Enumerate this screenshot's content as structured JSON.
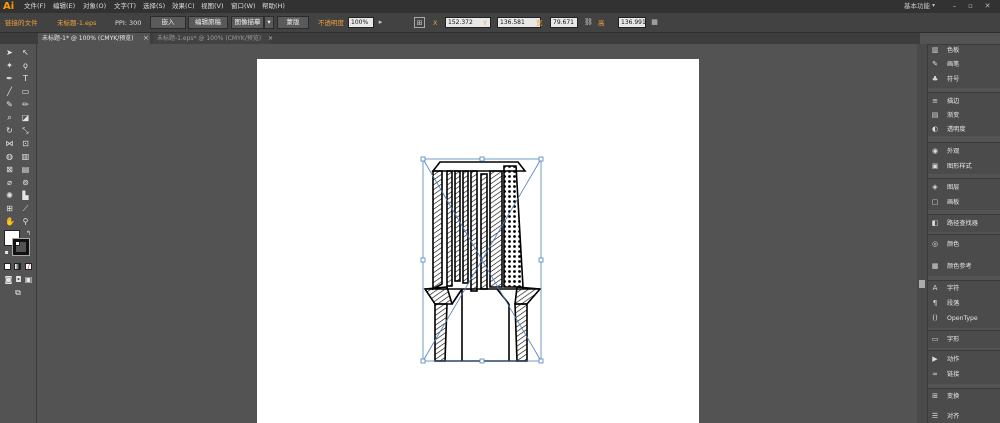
{
  "app": {
    "logo": "Ai",
    "workspace": "基本功能"
  },
  "menu": [
    "文件(F)",
    "编辑(E)",
    "对象(O)",
    "文字(T)",
    "选择(S)",
    "效果(C)",
    "视图(V)",
    "窗口(W)",
    "帮助(H)"
  ],
  "control": {
    "linked_file": "链接的文件",
    "file_name": "未标题-1.eps",
    "ppi_label": "PPI: 300",
    "embed": "嵌入",
    "edit_original": "编辑原稿",
    "image_trace": "图像描摹",
    "mask": "蒙版",
    "opacity_label": "不透明度",
    "opacity_value": "100%",
    "x_label": "X",
    "x_value": "152.372",
    "y_label": "Y",
    "y_value": "136.581",
    "w_label": "宽",
    "w_value": "79.671",
    "h_label": "高",
    "h_value": "136.991"
  },
  "tabs": [
    {
      "label": "未标题-1* @ 100% (CMYK/预览)",
      "close": "×",
      "active": true
    },
    {
      "label": "未标题-1.eps* @ 100% (CMYK/预览)",
      "close": "×",
      "active": false
    }
  ],
  "panels": [
    {
      "icon": "color-icon",
      "glyph": "▥",
      "label": "色板"
    },
    {
      "icon": "brush-icon",
      "glyph": "✎",
      "label": "画笔"
    },
    {
      "icon": "symbol-icon",
      "glyph": "♣",
      "label": "符号"
    },
    {
      "icon": "stroke-icon",
      "glyph": "≡",
      "label": "描边"
    },
    {
      "icon": "gradient-icon",
      "glyph": "▤",
      "label": "渐变"
    },
    {
      "icon": "transparency-icon",
      "glyph": "◐",
      "label": "透明度"
    },
    {
      "icon": "appearance-icon",
      "glyph": "◉",
      "label": "外观"
    },
    {
      "icon": "graphic-styles-icon",
      "glyph": "▣",
      "label": "图形样式"
    },
    {
      "icon": "layers-icon",
      "glyph": "◈",
      "label": "图层"
    },
    {
      "icon": "artboards-icon",
      "glyph": "▢",
      "label": "画板"
    },
    {
      "icon": "pathfinder-icon",
      "glyph": "◧",
      "label": "路径查找器"
    },
    {
      "icon": "color-guide-icon",
      "glyph": "◎",
      "label": "颜色"
    },
    {
      "icon": "color-ref-icon",
      "glyph": "▦",
      "label": "颜色参考"
    },
    {
      "icon": "character-icon",
      "glyph": "A",
      "label": "字符"
    },
    {
      "icon": "paragraph-icon",
      "glyph": "¶",
      "label": "段落"
    },
    {
      "icon": "opentype-icon",
      "glyph": "()",
      "label": "OpenType"
    },
    {
      "icon": "glyphs-icon",
      "glyph": "▭",
      "label": "字形"
    },
    {
      "icon": "actions-icon",
      "glyph": "▶",
      "label": "动作"
    },
    {
      "icon": "links-icon",
      "glyph": "∞",
      "label": "链接"
    },
    {
      "icon": "transform-icon",
      "glyph": "⊞",
      "label": "变换"
    },
    {
      "icon": "align-icon",
      "glyph": "☰",
      "label": "对齐"
    }
  ]
}
